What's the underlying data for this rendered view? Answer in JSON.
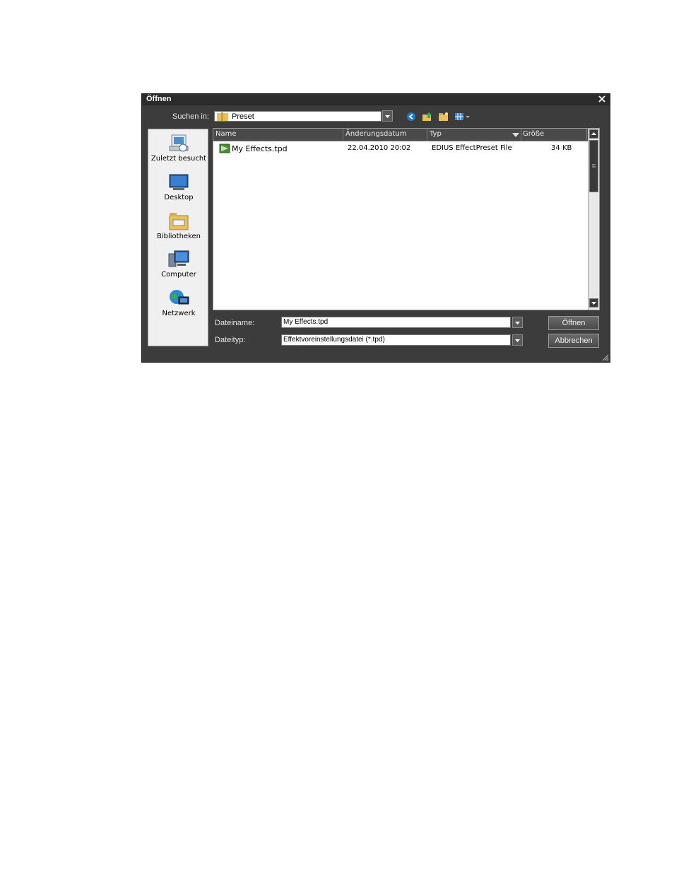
{
  "dialog": {
    "title": "Öffnen",
    "look_in": {
      "label": "Suchen in:",
      "value": "Preset"
    },
    "places": [
      {
        "label": "Zuletzt besucht",
        "icon": "recent-places-icon"
      },
      {
        "label": "Desktop",
        "icon": "desktop-icon"
      },
      {
        "label": "Bibliotheken",
        "icon": "libraries-icon"
      },
      {
        "label": "Computer",
        "icon": "computer-icon"
      },
      {
        "label": "Netzwerk",
        "icon": "network-icon"
      }
    ],
    "columns": [
      "Name",
      "Änderungsdatum",
      "Typ",
      "Größe"
    ],
    "files": [
      {
        "name": "My Effects.tpd",
        "date": "22.04.2010 20:02",
        "type": "EDIUS EffectPreset File",
        "size": "34 KB"
      }
    ],
    "filename": {
      "label": "Dateiname:",
      "value": "My Effects.tpd"
    },
    "filetype": {
      "label": "Dateityp:",
      "value": "Effektvoreinstellungsdatei (*.tpd)"
    },
    "open_label": "Öffnen",
    "cancel_label": "Abbrechen"
  }
}
